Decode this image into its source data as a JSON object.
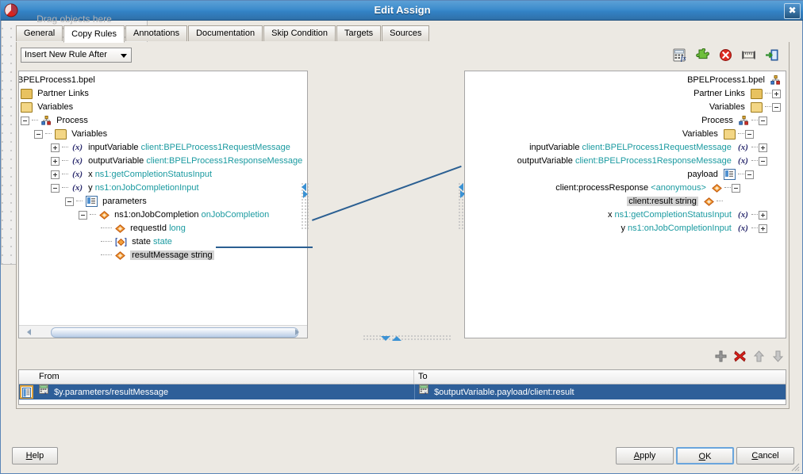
{
  "window": {
    "title": "Edit Assign",
    "app_icon": "oracle-logo-icon",
    "close_label": "✖"
  },
  "tabs": [
    {
      "label": "General",
      "active": false
    },
    {
      "label": "Copy Rules",
      "active": true
    },
    {
      "label": "Annotations",
      "active": false
    },
    {
      "label": "Documentation",
      "active": false
    },
    {
      "label": "Skip Condition",
      "active": false
    },
    {
      "label": "Targets",
      "active": false
    },
    {
      "label": "Sources",
      "active": false
    }
  ],
  "toolbar": {
    "rule_mode": "Insert New Rule After",
    "icons": [
      {
        "name": "expression-builder-icon",
        "title": "Expression Builder"
      },
      {
        "name": "extension-function-icon",
        "title": "Function"
      },
      {
        "name": "delete-icon",
        "title": "Delete"
      },
      {
        "name": "ruler-icon",
        "title": "Ruler"
      },
      {
        "name": "export-icon",
        "title": "Export"
      }
    ]
  },
  "middle_panel": {
    "placeholder": "Drag objects here"
  },
  "left_tree": {
    "nodes": [
      {
        "indent": 0,
        "toggle": "none",
        "icon": "none",
        "label": "BPELProcess1.bpel",
        "type": ""
      },
      {
        "indent": 0,
        "toggle": "none",
        "icon": "folder",
        "label": "Partner Links",
        "type": ""
      },
      {
        "indent": 0,
        "toggle": "none",
        "icon": "folder-open",
        "label": "Variables",
        "type": ""
      },
      {
        "indent": 1,
        "toggle": "minus",
        "icon": "process",
        "label": "Process",
        "type": ""
      },
      {
        "indent": 2,
        "toggle": "minus",
        "icon": "folder-open",
        "label": "Variables",
        "type": ""
      },
      {
        "indent": 3,
        "toggle": "plus",
        "icon": "xvar",
        "label": "inputVariable",
        "type": "client:BPELProcess1RequestMessage"
      },
      {
        "indent": 3,
        "toggle": "plus",
        "icon": "xvar",
        "label": "outputVariable",
        "type": "client:BPELProcess1ResponseMessage"
      },
      {
        "indent": 3,
        "toggle": "plus",
        "icon": "xvar",
        "label": "x",
        "type": "ns1:getCompletionStatusInput"
      },
      {
        "indent": 3,
        "toggle": "minus",
        "icon": "xvar",
        "label": "y",
        "type": "ns1:onJobCompletionInput"
      },
      {
        "indent": 4,
        "toggle": "minus",
        "icon": "doc",
        "label": "parameters",
        "type": ""
      },
      {
        "indent": 5,
        "toggle": "minus",
        "icon": "element",
        "label": "ns1:onJobCompletion",
        "type": "onJobCompletion"
      },
      {
        "indent": 6,
        "toggle": "leaf",
        "icon": "element",
        "label": "requestId",
        "type": "long"
      },
      {
        "indent": 6,
        "toggle": "leaf",
        "icon": "attribute",
        "label": "state",
        "type": "state"
      },
      {
        "indent": 6,
        "toggle": "leaf",
        "icon": "element",
        "label": "resultMessage string",
        "type": "",
        "selected": true
      }
    ]
  },
  "right_tree": {
    "nodes": [
      {
        "indent": 0,
        "toggle": "none",
        "icon": "process",
        "label": "BPELProcess1.bpel",
        "type": ""
      },
      {
        "indent": 0,
        "toggle": "plus",
        "icon": "folder",
        "label": "Partner Links",
        "type": ""
      },
      {
        "indent": 0,
        "toggle": "minus",
        "icon": "folder-open",
        "label": "Variables",
        "type": ""
      },
      {
        "indent": 1,
        "toggle": "minus",
        "icon": "process",
        "label": "Process",
        "type": ""
      },
      {
        "indent": 2,
        "toggle": "minus",
        "icon": "folder-open",
        "label": "Variables",
        "type": ""
      },
      {
        "indent": 3,
        "toggle": "plus",
        "icon": "xvar",
        "label": "inputVariable",
        "type": "client:BPELProcess1RequestMessage"
      },
      {
        "indent": 3,
        "toggle": "minus",
        "icon": "xvar",
        "label": "outputVariable",
        "type": "client:BPELProcess1ResponseMessage"
      },
      {
        "indent": 4,
        "toggle": "minus",
        "icon": "doc",
        "label": "payload",
        "type": ""
      },
      {
        "indent": 5,
        "toggle": "minus",
        "icon": "element",
        "label": "client:processResponse",
        "type": "<anonymous>"
      },
      {
        "indent": 6,
        "toggle": "leaf",
        "icon": "element",
        "label": "client:result string",
        "type": "",
        "selected": true
      },
      {
        "indent": 3,
        "toggle": "plus",
        "icon": "xvar",
        "label": "x",
        "type": "ns1:getCompletionStatusInput"
      },
      {
        "indent": 3,
        "toggle": "plus",
        "icon": "xvar",
        "label": "y",
        "type": "ns1:onJobCompletionInput"
      }
    ]
  },
  "row_actions": [
    {
      "name": "add-rule-button",
      "glyph": "+"
    },
    {
      "name": "delete-rule-button",
      "glyph": "✖"
    },
    {
      "name": "move-up-button",
      "glyph": "↑"
    },
    {
      "name": "move-down-button",
      "glyph": "↓"
    }
  ],
  "rules_table": {
    "columns": [
      "From",
      "To"
    ],
    "rows": [
      {
        "from": "$y.parameters/resultMessage",
        "to": "$outputVariable.payload/client:result",
        "selected": true
      }
    ]
  },
  "buttons": {
    "help": "Help",
    "apply": "Apply",
    "ok": "OK",
    "cancel": "Cancel"
  },
  "colors": {
    "title_bar": "#3383c6",
    "selection": "#2e5f99",
    "type_text": "#1a9aa0",
    "connector": "#2b5f92",
    "tree_select_bg": "#d3d3d3"
  }
}
